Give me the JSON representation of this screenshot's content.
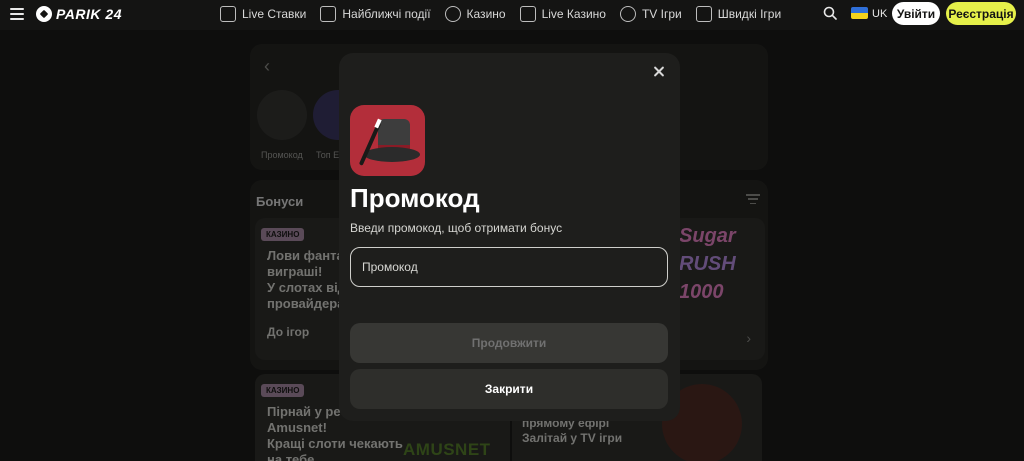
{
  "header": {
    "logo_text": "PARIK 24",
    "nav": [
      {
        "label": "Live Ставки",
        "icon": "live-bets-icon"
      },
      {
        "label": "Найближчі події",
        "icon": "calendar-icon"
      },
      {
        "label": "Казино",
        "icon": "casino-chip-icon"
      },
      {
        "label": "Live Казино",
        "icon": "cards-icon"
      },
      {
        "label": "TV Ігри",
        "icon": "tv-games-icon"
      },
      {
        "label": "Швидкі Ігри",
        "icon": "rocket-icon"
      }
    ],
    "language": "UK",
    "login_label": "Увійти",
    "register_label": "Реєстрація"
  },
  "background": {
    "categories": [
      {
        "label": "Промокод"
      },
      {
        "label": "Топ Е"
      }
    ],
    "bonuses_title": "Бонуси",
    "promo1": {
      "tag": "КАЗИНО",
      "text": "Лови фанта\nвиграші!\nУ слотах від\nпровайдера",
      "link": "До ігор",
      "art_lines": [
        "Sugar",
        "RUSH",
        "1000"
      ]
    },
    "promo2": {
      "tag": "КАЗИНО",
      "text": "Пірнай у ре\nAmusnet!\nКращі слоти чекають\nна тебе",
      "brand": "AMUSNET"
    },
    "promo3": {
      "text": "прямому ефірі\nЗалітай у TV ігри"
    }
  },
  "modal": {
    "title": "Промокод",
    "subtitle": "Введи промокод, щоб отримати бонус",
    "input_placeholder": "Промокод",
    "input_value": "",
    "continue_label": "Продовжити",
    "close_label": "Закрити"
  },
  "colors": {
    "accent_yellow": "#e6f14a",
    "tag_purple": "#a487a0",
    "icon_red": "#b32e3a"
  }
}
